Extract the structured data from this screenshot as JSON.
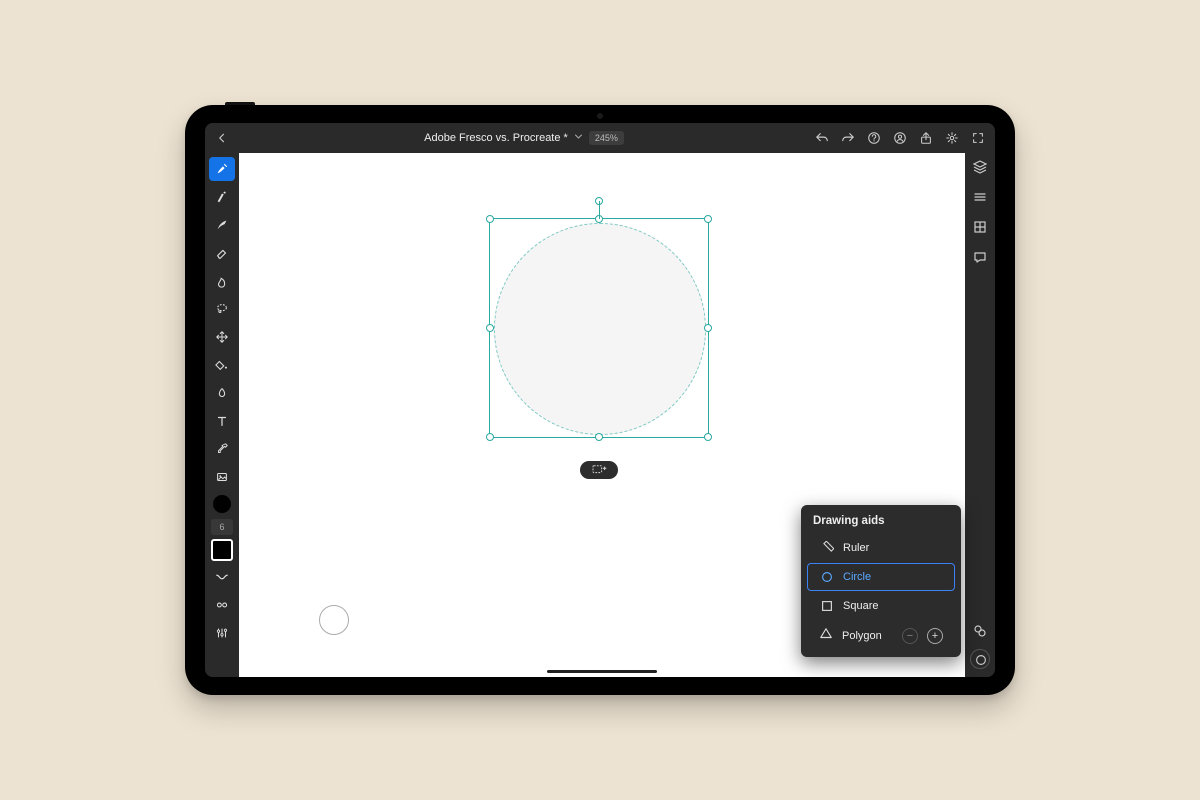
{
  "header": {
    "doc_title": "Adobe Fresco vs. Procreate *",
    "zoom": "245%"
  },
  "left_toolbar": {
    "brush_size": "6"
  },
  "popup": {
    "title": "Drawing aids",
    "items": {
      "ruler": "Ruler",
      "circle": "Circle",
      "square": "Square",
      "polygon": "Polygon"
    }
  },
  "colors": {
    "accent": "#1473e6",
    "selection": "#2aa9a0"
  }
}
